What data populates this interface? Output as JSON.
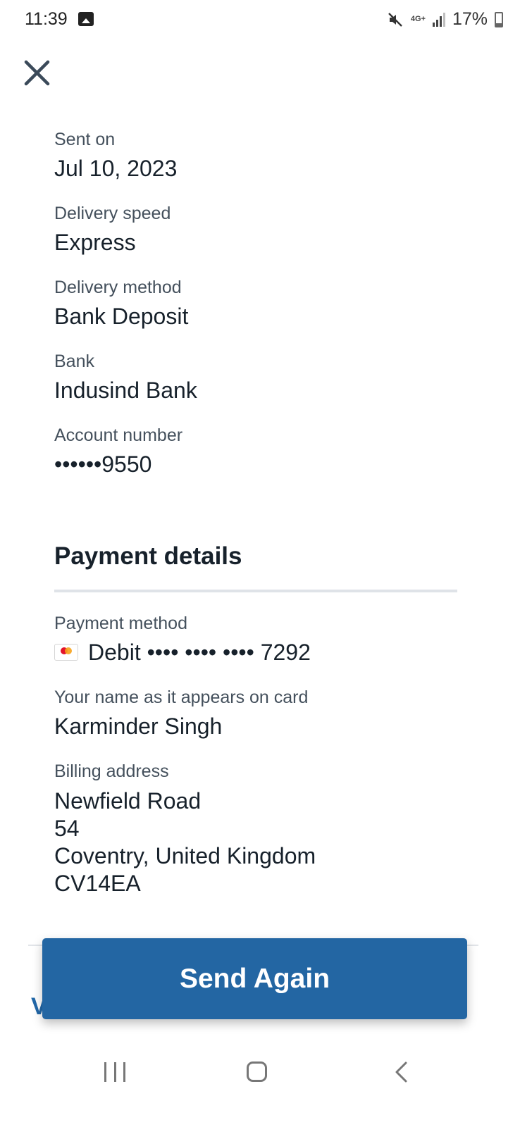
{
  "status_bar": {
    "time": "11:39",
    "network": "4G+",
    "battery": "17%"
  },
  "details": {
    "sent_on": {
      "label": "Sent on",
      "value": "Jul 10, 2023"
    },
    "delivery_speed": {
      "label": "Delivery speed",
      "value": "Express"
    },
    "delivery_method": {
      "label": "Delivery method",
      "value": "Bank Deposit"
    },
    "bank": {
      "label": "Bank",
      "value": "Indusind Bank"
    },
    "account_number": {
      "label": "Account number",
      "value": "••••••9550"
    }
  },
  "payment": {
    "title": "Payment details",
    "method": {
      "label": "Payment method",
      "value": "Debit •••• •••• •••• 7292",
      "card_icon": "mastercard-icon"
    },
    "cardholder": {
      "label": "Your name as it appears on card",
      "value": "Karminder Singh"
    },
    "billing": {
      "label": "Billing address",
      "lines": [
        "Newfield Road",
        "54",
        "Coventry, United Kingdom",
        "CV14EA"
      ]
    }
  },
  "actions": {
    "send_again": "Send Again",
    "partial_link": "V"
  },
  "colors": {
    "primary": "#2366a3",
    "text": "#17212b",
    "label": "#44505c"
  }
}
